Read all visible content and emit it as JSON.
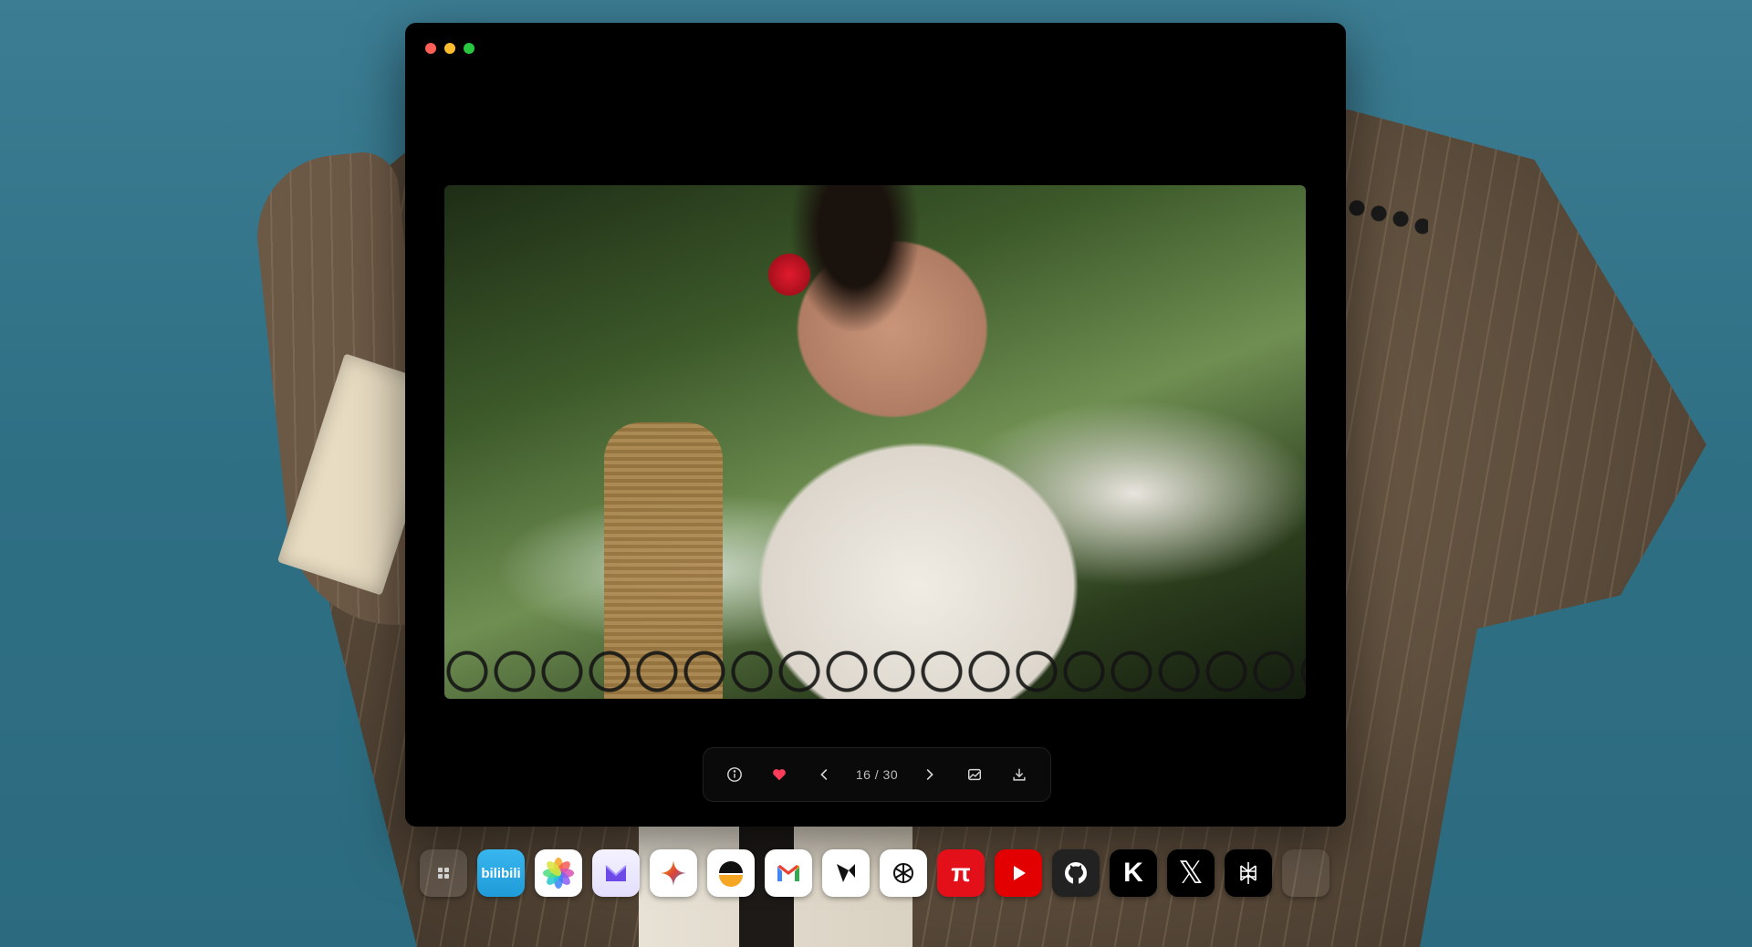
{
  "viewer": {
    "counter": "16 / 30",
    "icons": {
      "info": "info-icon",
      "favorite": "heart-icon",
      "prev": "chevron-left-icon",
      "next": "chevron-right-icon",
      "wallpaper": "image-icon",
      "download": "download-icon"
    },
    "favorite_color": "#ff3b5c"
  },
  "window": {
    "traffic_lights": [
      "#ff5f57",
      "#febc2e",
      "#28c840"
    ]
  },
  "dock": {
    "apps": [
      {
        "name": "launchpad",
        "label": ""
      },
      {
        "name": "bilibili",
        "label": "bilibili"
      },
      {
        "name": "photos",
        "label": ""
      },
      {
        "name": "mail",
        "label": ""
      },
      {
        "name": "gemini",
        "label": ""
      },
      {
        "name": "stocks",
        "label": ""
      },
      {
        "name": "gmail",
        "label": ""
      },
      {
        "name": "perplexity",
        "label": ""
      },
      {
        "name": "chatgpt",
        "label": ""
      },
      {
        "name": "pi",
        "label": "π"
      },
      {
        "name": "youtube",
        "label": ""
      },
      {
        "name": "github",
        "label": ""
      },
      {
        "name": "kimi",
        "label": "K"
      },
      {
        "name": "x",
        "label": "𝕏"
      },
      {
        "name": "perplexity-alt",
        "label": ""
      },
      {
        "name": "empty",
        "label": ""
      }
    ]
  }
}
